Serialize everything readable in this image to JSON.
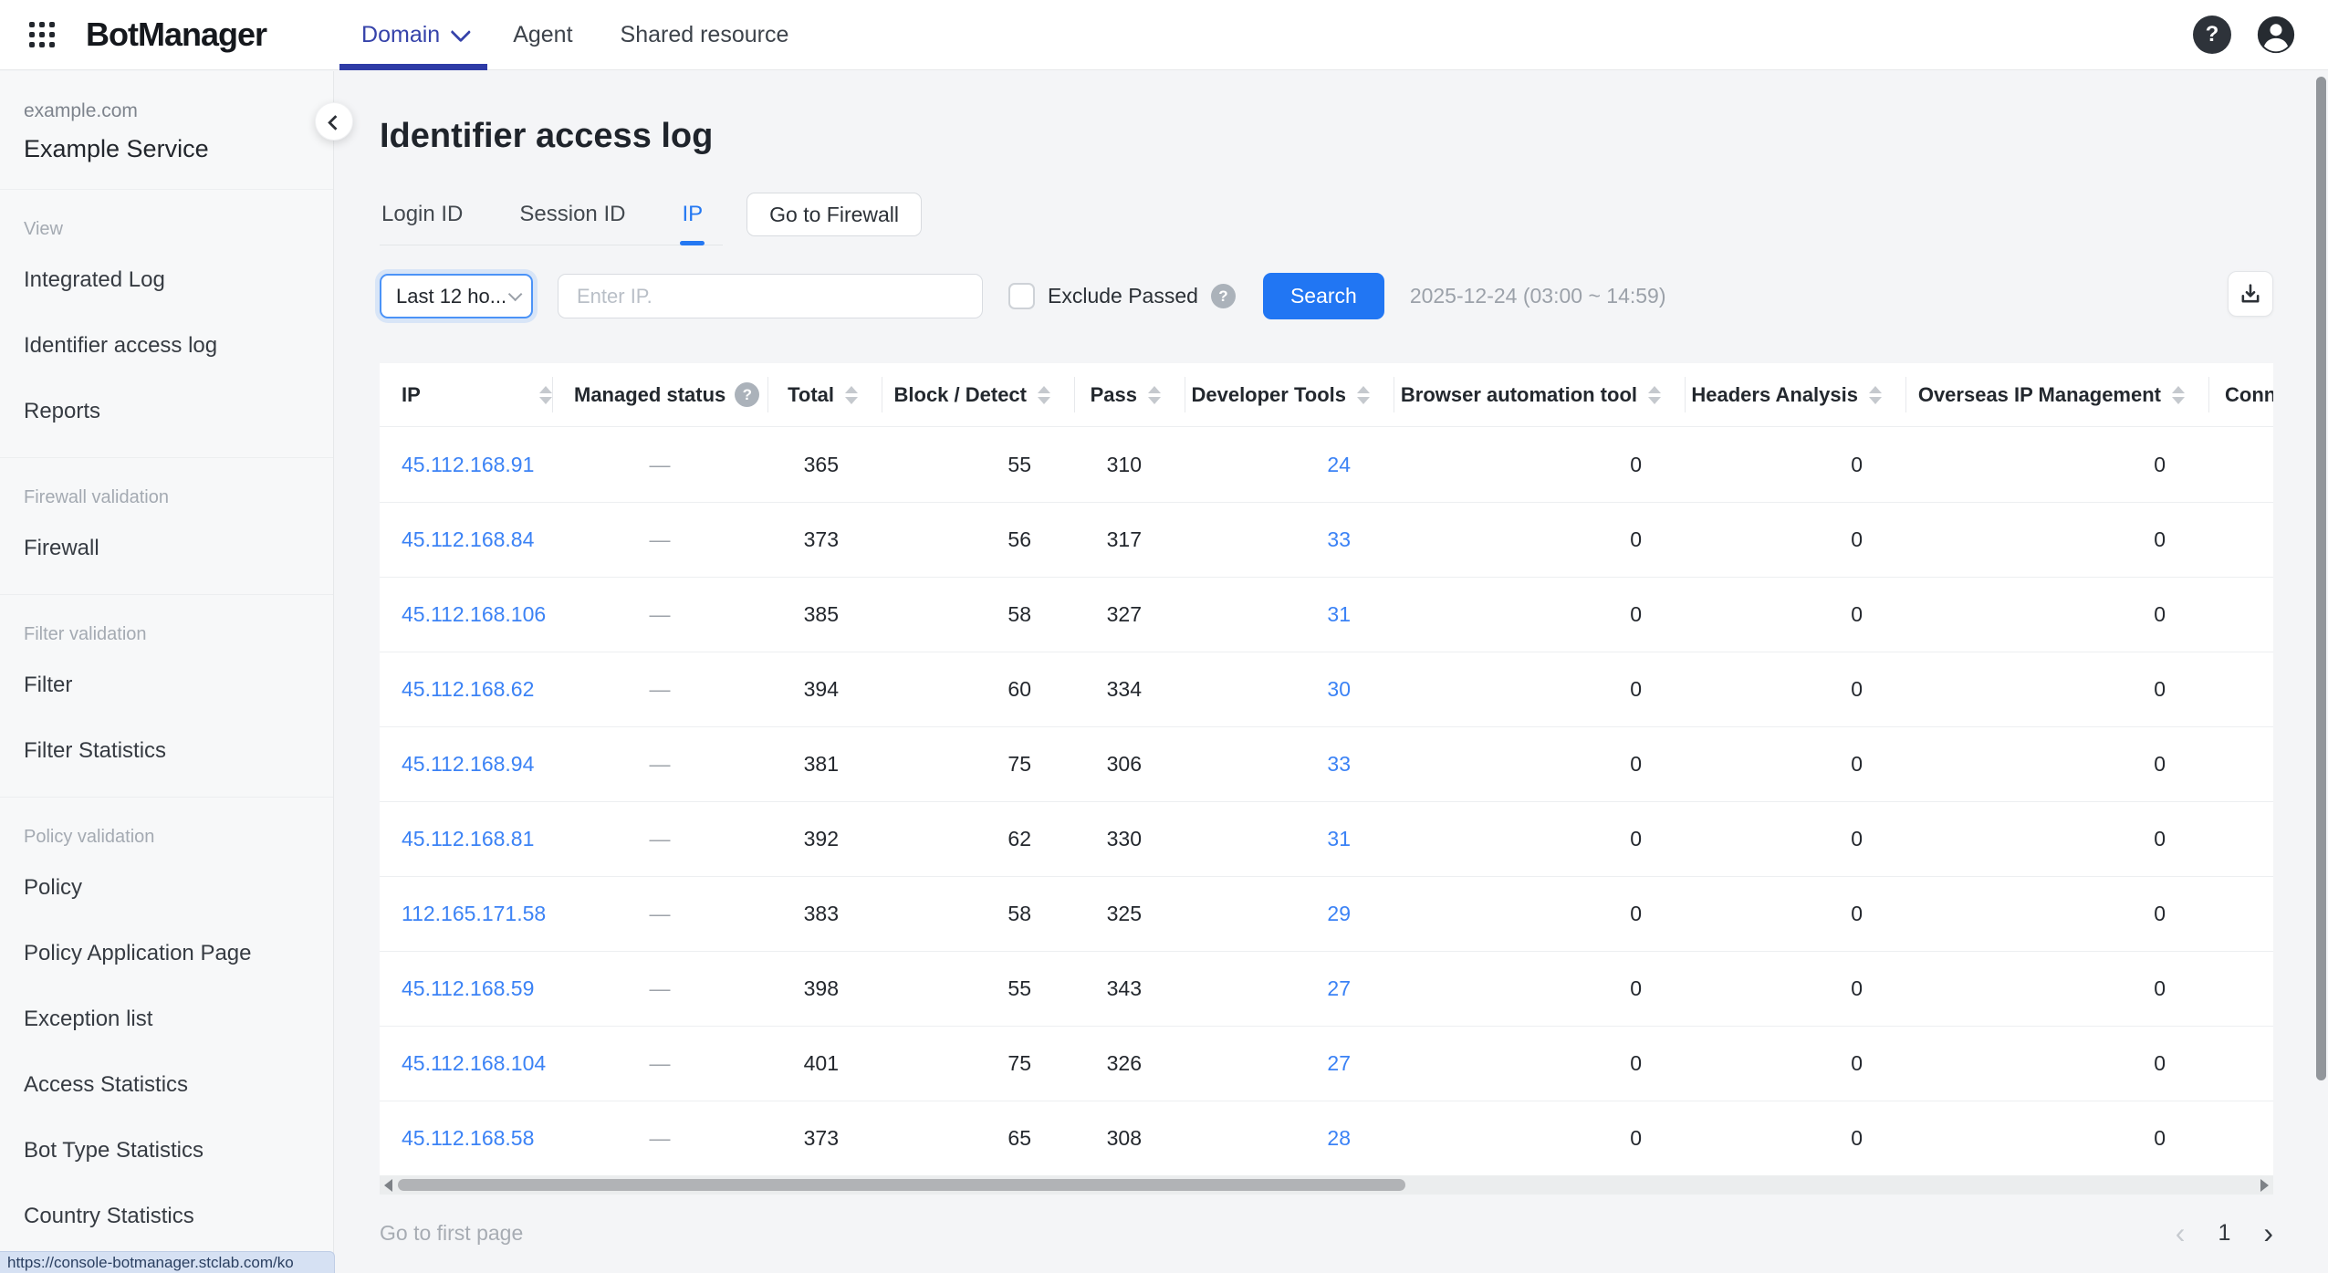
{
  "topbar": {
    "logo": "BotManager",
    "nav": [
      {
        "label": "Domain",
        "active": true,
        "has_dropdown": true
      },
      {
        "label": "Agent",
        "active": false,
        "has_dropdown": false
      },
      {
        "label": "Shared resource",
        "active": false,
        "has_dropdown": false
      }
    ]
  },
  "sidebar": {
    "domain": "example.com",
    "service": "Example Service",
    "sections": [
      {
        "label": "View",
        "items": [
          "Integrated Log",
          "Identifier access log",
          "Reports"
        ]
      },
      {
        "label": "Firewall validation",
        "items": [
          "Firewall"
        ]
      },
      {
        "label": "Filter validation",
        "items": [
          "Filter",
          "Filter Statistics"
        ]
      },
      {
        "label": "Policy validation",
        "items": [
          "Policy",
          "Policy Application Page",
          "Exception list",
          "Access Statistics",
          "Bot Type Statistics",
          "Country Statistics"
        ]
      }
    ]
  },
  "statusbar_url": "https://console-botmanager.stclab.com/ko",
  "page": {
    "title": "Identifier access log",
    "tabs": [
      {
        "label": "Login ID",
        "active": false
      },
      {
        "label": "Session ID",
        "active": false
      },
      {
        "label": "IP",
        "active": true
      }
    ],
    "firewall_button": "Go to Firewall"
  },
  "filters": {
    "period": "Last 12 ho...",
    "ip_placeholder": "Enter IP.",
    "exclude_label": "Exclude Passed",
    "search_label": "Search",
    "date_range": "2025-12-24 (03:00 ~ 14:59)"
  },
  "table": {
    "columns": [
      {
        "key": "ip",
        "label": "IP",
        "sortable": true,
        "help": false
      },
      {
        "key": "managed",
        "label": "Managed status",
        "sortable": false,
        "help": true
      },
      {
        "key": "total",
        "label": "Total",
        "sortable": true,
        "help": false
      },
      {
        "key": "block",
        "label": "Block / Detect",
        "sortable": true,
        "help": false
      },
      {
        "key": "pass",
        "label": "Pass",
        "sortable": true,
        "help": false
      },
      {
        "key": "devtools",
        "label": "Developer Tools",
        "sortable": true,
        "help": false
      },
      {
        "key": "browser_automation",
        "label": "Browser automation tool",
        "sortable": true,
        "help": false
      },
      {
        "key": "headers",
        "label": "Headers Analysis",
        "sortable": true,
        "help": false
      },
      {
        "key": "overseas",
        "label": "Overseas IP Management",
        "sortable": true,
        "help": false
      },
      {
        "key": "connection",
        "label": "Conn",
        "sortable": false,
        "help": false
      }
    ],
    "rows": [
      {
        "ip": "45.112.168.91",
        "managed": "—",
        "total": "365",
        "block": "55",
        "pass": "310",
        "devtools": "24",
        "browser_automation": "0",
        "headers": "0",
        "overseas": "0",
        "connection": ""
      },
      {
        "ip": "45.112.168.84",
        "managed": "—",
        "total": "373",
        "block": "56",
        "pass": "317",
        "devtools": "33",
        "browser_automation": "0",
        "headers": "0",
        "overseas": "0",
        "connection": ""
      },
      {
        "ip": "45.112.168.106",
        "managed": "—",
        "total": "385",
        "block": "58",
        "pass": "327",
        "devtools": "31",
        "browser_automation": "0",
        "headers": "0",
        "overseas": "0",
        "connection": ""
      },
      {
        "ip": "45.112.168.62",
        "managed": "—",
        "total": "394",
        "block": "60",
        "pass": "334",
        "devtools": "30",
        "browser_automation": "0",
        "headers": "0",
        "overseas": "0",
        "connection": ""
      },
      {
        "ip": "45.112.168.94",
        "managed": "—",
        "total": "381",
        "block": "75",
        "pass": "306",
        "devtools": "33",
        "browser_automation": "0",
        "headers": "0",
        "overseas": "0",
        "connection": ""
      },
      {
        "ip": "45.112.168.81",
        "managed": "—",
        "total": "392",
        "block": "62",
        "pass": "330",
        "devtools": "31",
        "browser_automation": "0",
        "headers": "0",
        "overseas": "0",
        "connection": ""
      },
      {
        "ip": "112.165.171.58",
        "managed": "—",
        "total": "383",
        "block": "58",
        "pass": "325",
        "devtools": "29",
        "browser_automation": "0",
        "headers": "0",
        "overseas": "0",
        "connection": ""
      },
      {
        "ip": "45.112.168.59",
        "managed": "—",
        "total": "398",
        "block": "55",
        "pass": "343",
        "devtools": "27",
        "browser_automation": "0",
        "headers": "0",
        "overseas": "0",
        "connection": ""
      },
      {
        "ip": "45.112.168.104",
        "managed": "—",
        "total": "401",
        "block": "75",
        "pass": "326",
        "devtools": "27",
        "browser_automation": "0",
        "headers": "0",
        "overseas": "0",
        "connection": ""
      },
      {
        "ip": "45.112.168.58",
        "managed": "—",
        "total": "373",
        "block": "65",
        "pass": "308",
        "devtools": "28",
        "browser_automation": "0",
        "headers": "0",
        "overseas": "0",
        "connection": ""
      }
    ]
  },
  "pagination": {
    "first_page_label": "Go to first page",
    "current_page": "1",
    "prev_glyph": "‹",
    "next_glyph": "›"
  },
  "colors": {
    "accent_blue": "#2176f3",
    "nav_indigo": "#2e3ba6",
    "link_blue": "#3b82f5",
    "topbar_bg": "#ffffff",
    "sidebar_bg": "#f7f8f9",
    "main_bg": "#f4f5f7",
    "table_bg": "#ffffff"
  }
}
